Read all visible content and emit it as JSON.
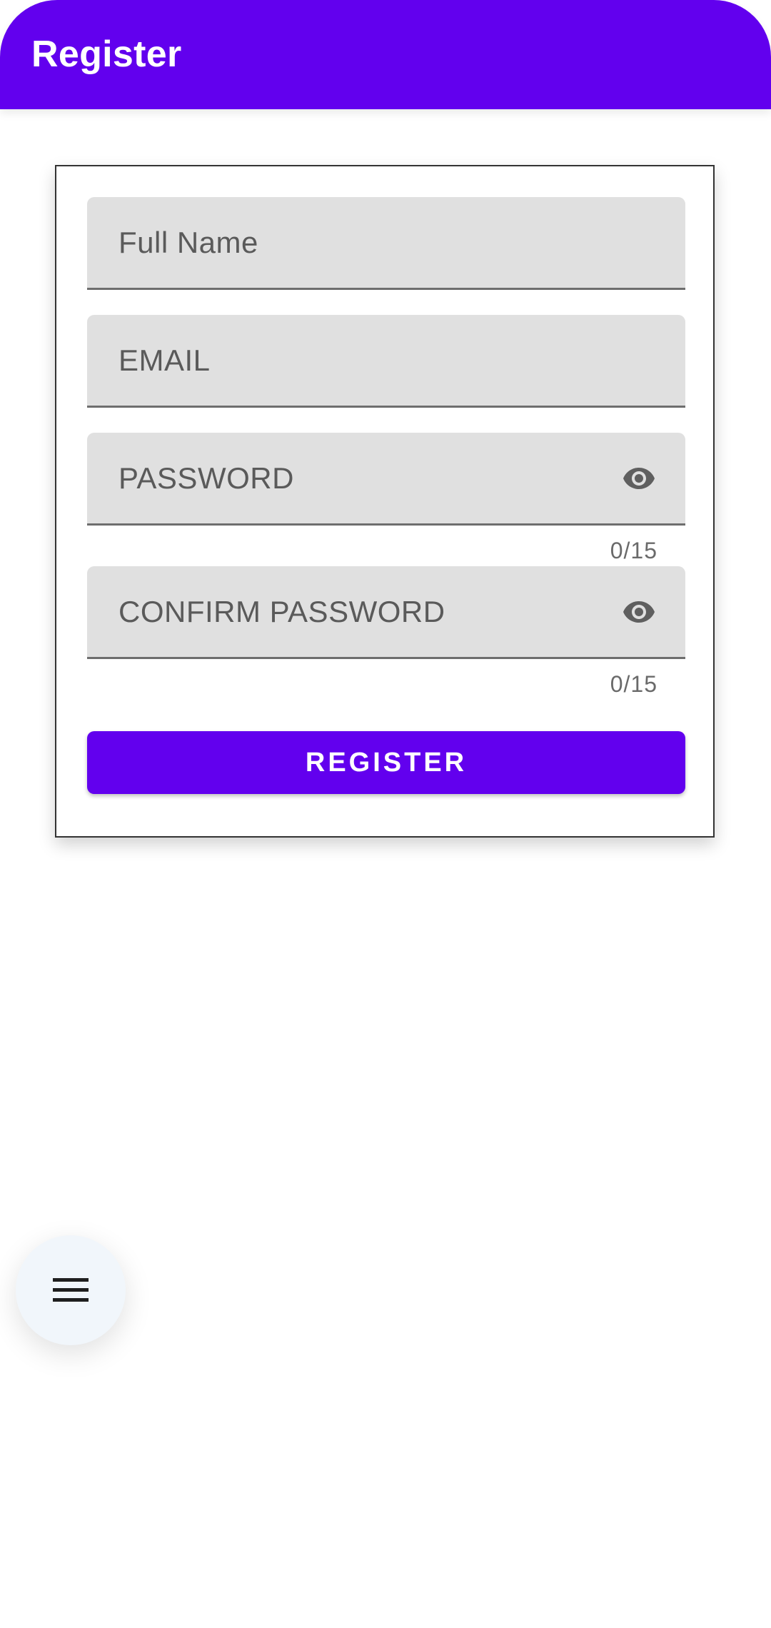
{
  "app_bar": {
    "title": "Register",
    "color": "#6200EE"
  },
  "form": {
    "full_name": {
      "placeholder": "Full Name"
    },
    "email": {
      "placeholder": "EMAIL"
    },
    "password": {
      "placeholder": "PASSWORD",
      "counter": "0/15",
      "icon": "eye-icon"
    },
    "confirm_password": {
      "placeholder": "CONFIRM PASSWORD",
      "counter": "0/15",
      "icon": "eye-icon"
    },
    "register_button": {
      "label": "REGISTER",
      "color": "#6200EE"
    }
  },
  "fab": {
    "icon": "menu-icon"
  }
}
